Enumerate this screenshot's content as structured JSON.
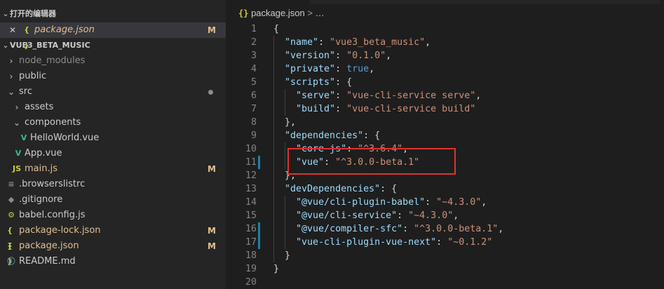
{
  "sidebar": {
    "open_editors": {
      "title": "打开的编辑器",
      "items": [
        {
          "close": "✕",
          "icon": "{ }",
          "label": "package.json",
          "status": "M"
        }
      ]
    },
    "project": {
      "title": "VUE3_BETA_MUSIC",
      "tree": [
        {
          "chev": "›",
          "icon": "",
          "label": "node_modules",
          "status": ""
        },
        {
          "chev": "›",
          "icon": "",
          "label": "public",
          "status": ""
        },
        {
          "chev": "⌄",
          "icon": "",
          "label": "src",
          "status": "dot"
        },
        {
          "chev": "›",
          "icon": "",
          "label": "assets",
          "status": ""
        },
        {
          "chev": "⌄",
          "icon": "",
          "label": "components",
          "status": ""
        },
        {
          "chev": "",
          "icon": "V",
          "label": "HelloWorld.vue",
          "status": ""
        },
        {
          "chev": "",
          "icon": "V",
          "label": "App.vue",
          "status": ""
        },
        {
          "chev": "",
          "icon": "JS",
          "label": "main.js",
          "status": "M"
        },
        {
          "chev": "",
          "icon": "≡",
          "label": ".browserslistrc",
          "status": ""
        },
        {
          "chev": "",
          "icon": "◆",
          "label": ".gitignore",
          "status": ""
        },
        {
          "chev": "",
          "icon": "⚙",
          "label": "babel.config.js",
          "status": ""
        },
        {
          "chev": "",
          "icon": "{ }",
          "label": "package-lock.json",
          "status": "M"
        },
        {
          "chev": "",
          "icon": "{ }",
          "label": "package.json",
          "status": "M"
        },
        {
          "chev": "",
          "icon": "ⓘ",
          "label": "README.md",
          "status": ""
        }
      ]
    }
  },
  "editor": {
    "breadcrumb": {
      "icon": "{}",
      "file": "package.json",
      "sep": ">",
      "more": "…"
    },
    "lines": [
      {
        "n": "1",
        "t": [
          [
            "p",
            "{"
          ]
        ]
      },
      {
        "n": "2",
        "t": [
          [
            "p",
            "  "
          ],
          [
            "k",
            "\"name\""
          ],
          [
            "p",
            ": "
          ],
          [
            "s",
            "\"vue3_beta_music\""
          ],
          [
            "p",
            ","
          ]
        ]
      },
      {
        "n": "3",
        "t": [
          [
            "p",
            "  "
          ],
          [
            "k",
            "\"version\""
          ],
          [
            "p",
            ": "
          ],
          [
            "s",
            "\"0.1.0\""
          ],
          [
            "p",
            ","
          ]
        ]
      },
      {
        "n": "4",
        "t": [
          [
            "p",
            "  "
          ],
          [
            "k",
            "\"private\""
          ],
          [
            "p",
            ": "
          ],
          [
            "b",
            "true"
          ],
          [
            "p",
            ","
          ]
        ]
      },
      {
        "n": "5",
        "t": [
          [
            "p",
            "  "
          ],
          [
            "k",
            "\"scripts\""
          ],
          [
            "p",
            ": {"
          ]
        ]
      },
      {
        "n": "6",
        "t": [
          [
            "p",
            "    "
          ],
          [
            "k",
            "\"serve\""
          ],
          [
            "p",
            ": "
          ],
          [
            "s",
            "\"vue-cli-service serve\""
          ],
          [
            "p",
            ","
          ]
        ]
      },
      {
        "n": "7",
        "t": [
          [
            "p",
            "    "
          ],
          [
            "k",
            "\"build\""
          ],
          [
            "p",
            ": "
          ],
          [
            "s",
            "\"vue-cli-service build\""
          ]
        ]
      },
      {
        "n": "8",
        "t": [
          [
            "p",
            "  },"
          ]
        ]
      },
      {
        "n": "9",
        "t": [
          [
            "p",
            "  "
          ],
          [
            "k",
            "\"dependencies\""
          ],
          [
            "p",
            ": {"
          ]
        ]
      },
      {
        "n": "10",
        "t": [
          [
            "p",
            "    "
          ],
          [
            "k",
            "\"core-js\""
          ],
          [
            "p",
            ": "
          ],
          [
            "s",
            "\"^3.6.4\""
          ],
          [
            "p",
            ","
          ]
        ]
      },
      {
        "n": "11",
        "t": [
          [
            "p",
            "    "
          ],
          [
            "k",
            "\"vue\""
          ],
          [
            "p",
            ": "
          ],
          [
            "s",
            "\"^3.0.0-beta.1\""
          ]
        ]
      },
      {
        "n": "12",
        "t": [
          [
            "p",
            "  },"
          ]
        ]
      },
      {
        "n": "13",
        "t": [
          [
            "p",
            "  "
          ],
          [
            "k",
            "\"devDependencies\""
          ],
          [
            "p",
            ": {"
          ]
        ]
      },
      {
        "n": "14",
        "t": [
          [
            "p",
            "    "
          ],
          [
            "k",
            "\"@vue/cli-plugin-babel\""
          ],
          [
            "p",
            ": "
          ],
          [
            "s",
            "\"~4.3.0\""
          ],
          [
            "p",
            ","
          ]
        ]
      },
      {
        "n": "15",
        "t": [
          [
            "p",
            "    "
          ],
          [
            "k",
            "\"@vue/cli-service\""
          ],
          [
            "p",
            ": "
          ],
          [
            "s",
            "\"~4.3.0\""
          ],
          [
            "p",
            ","
          ]
        ]
      },
      {
        "n": "16",
        "t": [
          [
            "p",
            "    "
          ],
          [
            "k",
            "\"@vue/compiler-sfc\""
          ],
          [
            "p",
            ": "
          ],
          [
            "s",
            "\"^3.0.0-beta.1\""
          ],
          [
            "p",
            ","
          ]
        ]
      },
      {
        "n": "17",
        "t": [
          [
            "p",
            "    "
          ],
          [
            "k",
            "\"vue-cli-plugin-vue-next\""
          ],
          [
            "p",
            ": "
          ],
          [
            "s",
            "\"~0.1.2\""
          ]
        ]
      },
      {
        "n": "18",
        "t": [
          [
            "p",
            "  }"
          ]
        ]
      },
      {
        "n": "19",
        "t": [
          [
            "p",
            "}"
          ]
        ]
      },
      {
        "n": "20",
        "t": []
      }
    ],
    "modified_lines": [
      "11",
      "16",
      "17"
    ],
    "highlight": "red-box"
  },
  "colors": {
    "key": "#9cdcfe",
    "string": "#ce9178",
    "boolean": "#569cd6",
    "highlight_box": "#e03131",
    "gutter_modified": "#1b81a8"
  }
}
